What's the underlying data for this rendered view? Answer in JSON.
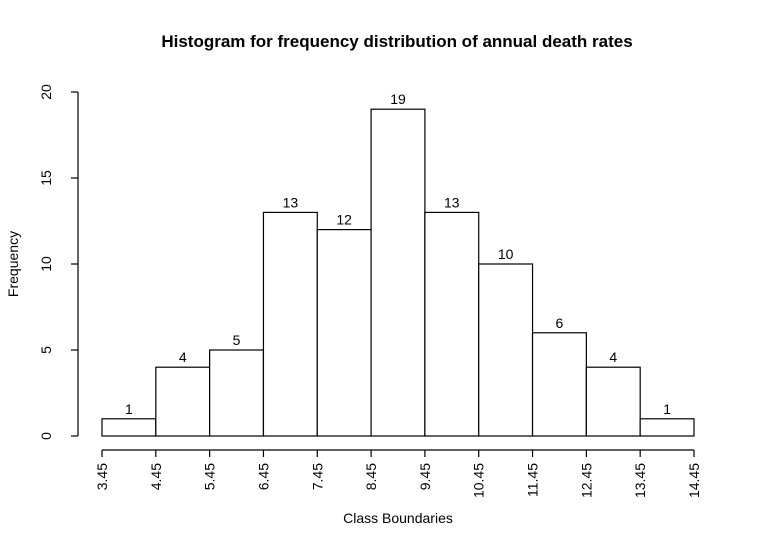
{
  "chart_data": {
    "type": "bar",
    "title": "Histogram for frequency distribution of annual death rates",
    "xlabel": "Class Boundaries",
    "ylabel": "Frequency",
    "class_boundaries": [
      "3.45",
      "4.45",
      "5.45",
      "6.45",
      "7.45",
      "8.45",
      "9.45",
      "10.45",
      "11.45",
      "12.45",
      "13.45",
      "14.45"
    ],
    "boundary_values": [
      3.45,
      4.45,
      5.45,
      6.45,
      7.45,
      8.45,
      9.45,
      10.45,
      11.45,
      12.45,
      13.45,
      14.45
    ],
    "categories": [
      "3.45-4.45",
      "4.45-5.45",
      "5.45-6.45",
      "6.45-7.45",
      "7.45-8.45",
      "8.45-9.45",
      "9.45-10.45",
      "10.45-11.45",
      "11.45-12.45",
      "12.45-13.45",
      "13.45-14.45"
    ],
    "values": [
      1,
      4,
      5,
      13,
      12,
      19,
      13,
      10,
      6,
      4,
      1
    ],
    "xlim": [
      3.45,
      14.45
    ],
    "ylim": [
      0,
      20
    ],
    "yticks": [
      0,
      5,
      10,
      15,
      20
    ],
    "grid": false,
    "legend": "none"
  }
}
